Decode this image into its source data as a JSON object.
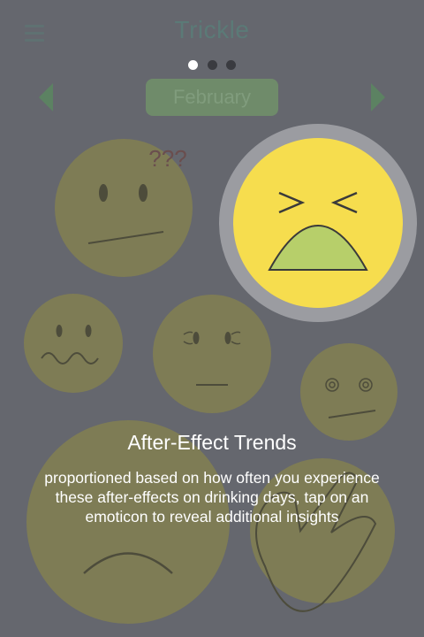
{
  "header": {
    "title": "Trickle",
    "menu_icon": "hamburger-menu-icon"
  },
  "pager": {
    "pages": 3,
    "active_index": 0
  },
  "month_selector": {
    "label": "February",
    "prev_icon": "chevron-left-icon",
    "next_icon": "chevron-right-icon"
  },
  "emoticons": [
    {
      "id": "confused",
      "label": "???"
    },
    {
      "id": "nauseous",
      "highlighted": true
    },
    {
      "id": "queasy"
    },
    {
      "id": "tired"
    },
    {
      "id": "dizzy"
    },
    {
      "id": "sad"
    },
    {
      "id": "hand"
    }
  ],
  "overlay": {
    "title": "After-Effect Trends",
    "description": "proportioned based on how often you experience these after-effects on drinking days, tap on an emoticon to reveal additional insights"
  },
  "colors": {
    "dim_background": "#65676e",
    "highlight_face": "#f6dd4e",
    "highlight_ring": "#9b9ca1",
    "mouth_fill": "#b7cf6a"
  }
}
